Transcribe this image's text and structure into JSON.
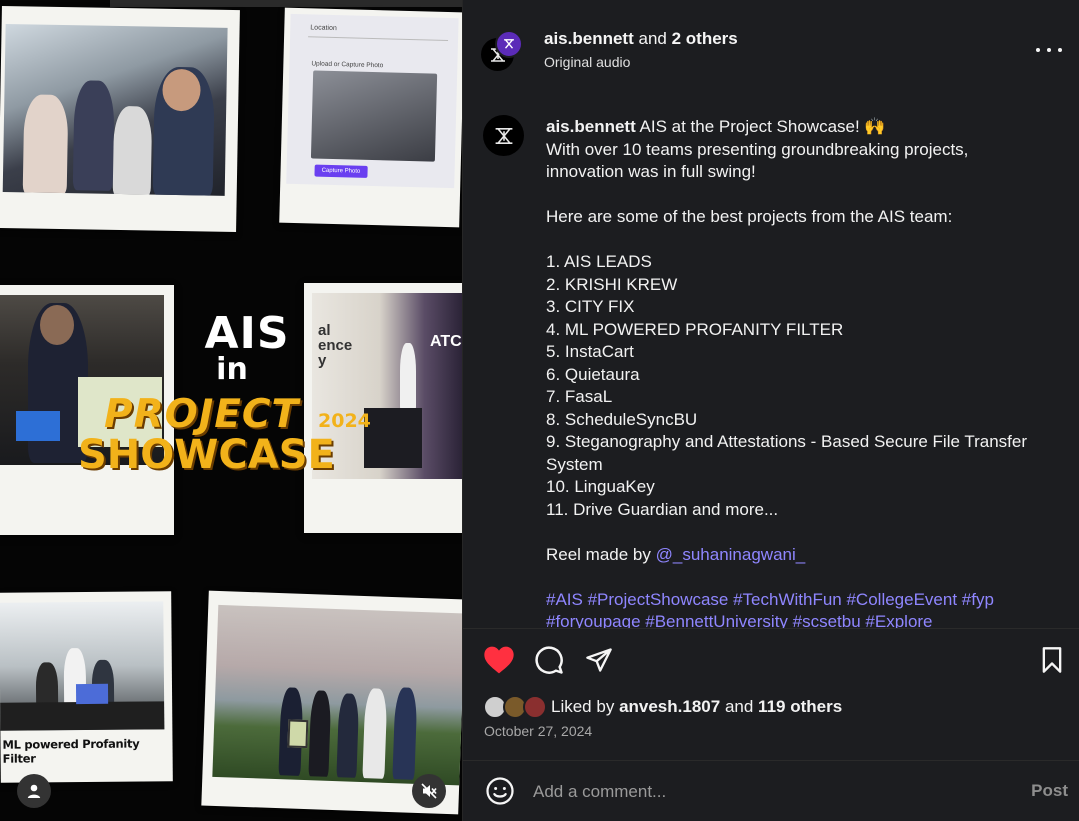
{
  "media": {
    "title_line1": "AIS",
    "title_line2": "in",
    "title_line3": "PROJECT",
    "title_year": "2024",
    "title_line4": "SHOWCASE",
    "photo2_location_label": "Location",
    "photo2_upload_label": "Upload or Capture Photo",
    "photo2_button": "Capture Photo",
    "photo5_caption": "ML powered Profanity Filter",
    "colors": {
      "accent_gold": "#f2b21a",
      "background": "#050505"
    }
  },
  "header": {
    "username": "ais.bennett",
    "collab_joiner": "and",
    "collab_others": "2 others",
    "audio": "Original audio"
  },
  "caption": {
    "username": "ais.bennett",
    "intro": " AIS at the Project Showcase! 🙌\nWith over 10 teams presenting groundbreaking projects, innovation was in full swing!\n\nHere are some of the best projects from the AIS team:\n\n1. AIS LEADS\n2. KRISHI KREW\n3. CITY FIX\n4. ML POWERED PROFANITY FILTER\n5. InstaCart\n6. Quietaura\n7. FasaL\n8. ScheduleSyncBU\n9. Steganography and Attestations - Based Secure File Transfer System\n10. LinguaKey\n11. Drive Guardian and more...\n\nReel made by ",
    "mention": "@_suhaninagwani_",
    "hashtags_line1": "#AIS #ProjectShowcase #TechWithFun #CollegeEvent #fyp",
    "hashtags_line2": "#foryoupage #BennettUniversity #scsetbu #Explore"
  },
  "likes": {
    "prefix": "Liked by",
    "first_liker": "anvesh.1807",
    "joiner": "and",
    "others": "119 others"
  },
  "date": "October 27, 2024",
  "comment": {
    "placeholder": "Add a comment...",
    "post_label": "Post"
  },
  "colors": {
    "like_red": "#ff3040",
    "link_blue": "#8f86ff",
    "panel_bg": "#1c1d20"
  }
}
